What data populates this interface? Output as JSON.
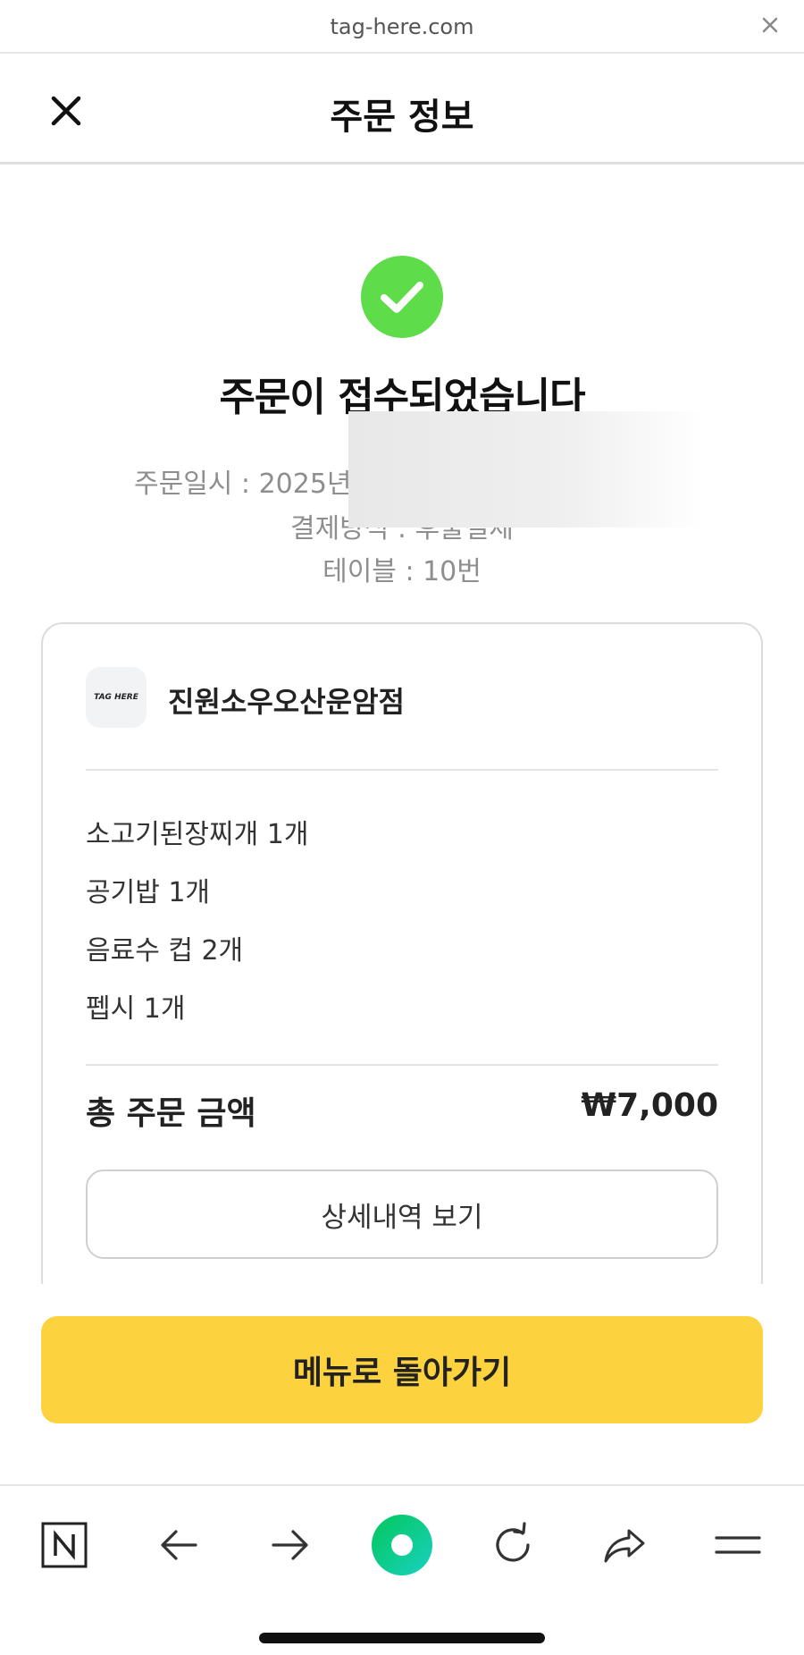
{
  "browser": {
    "url": "tag-here.com"
  },
  "header": {
    "title": "주문 정보"
  },
  "status": {
    "headline": "주문이 접수되었습니다"
  },
  "order_meta": {
    "date": "주문일시 : 2025년",
    "payment": "결제방식 : 후불결제",
    "table": "테이블 : 10번"
  },
  "store": {
    "logo_text": "TAG HERE",
    "name": "진원소우오산운암점"
  },
  "items": [
    {
      "text": "소고기된장찌개 1개"
    },
    {
      "text": "공기밥 1개"
    },
    {
      "text": "음료수 컵 2개"
    },
    {
      "text": "펩시 1개"
    }
  ],
  "total": {
    "label": "총 주문 금액",
    "value": "₩7,000"
  },
  "buttons": {
    "detail": "상세내역 보기",
    "back_to_menu": "메뉴로 돌아가기"
  },
  "colors": {
    "success_green": "#5fdc4a",
    "primary_yellow": "#fcd33f",
    "naver_green": "#03c75a"
  }
}
